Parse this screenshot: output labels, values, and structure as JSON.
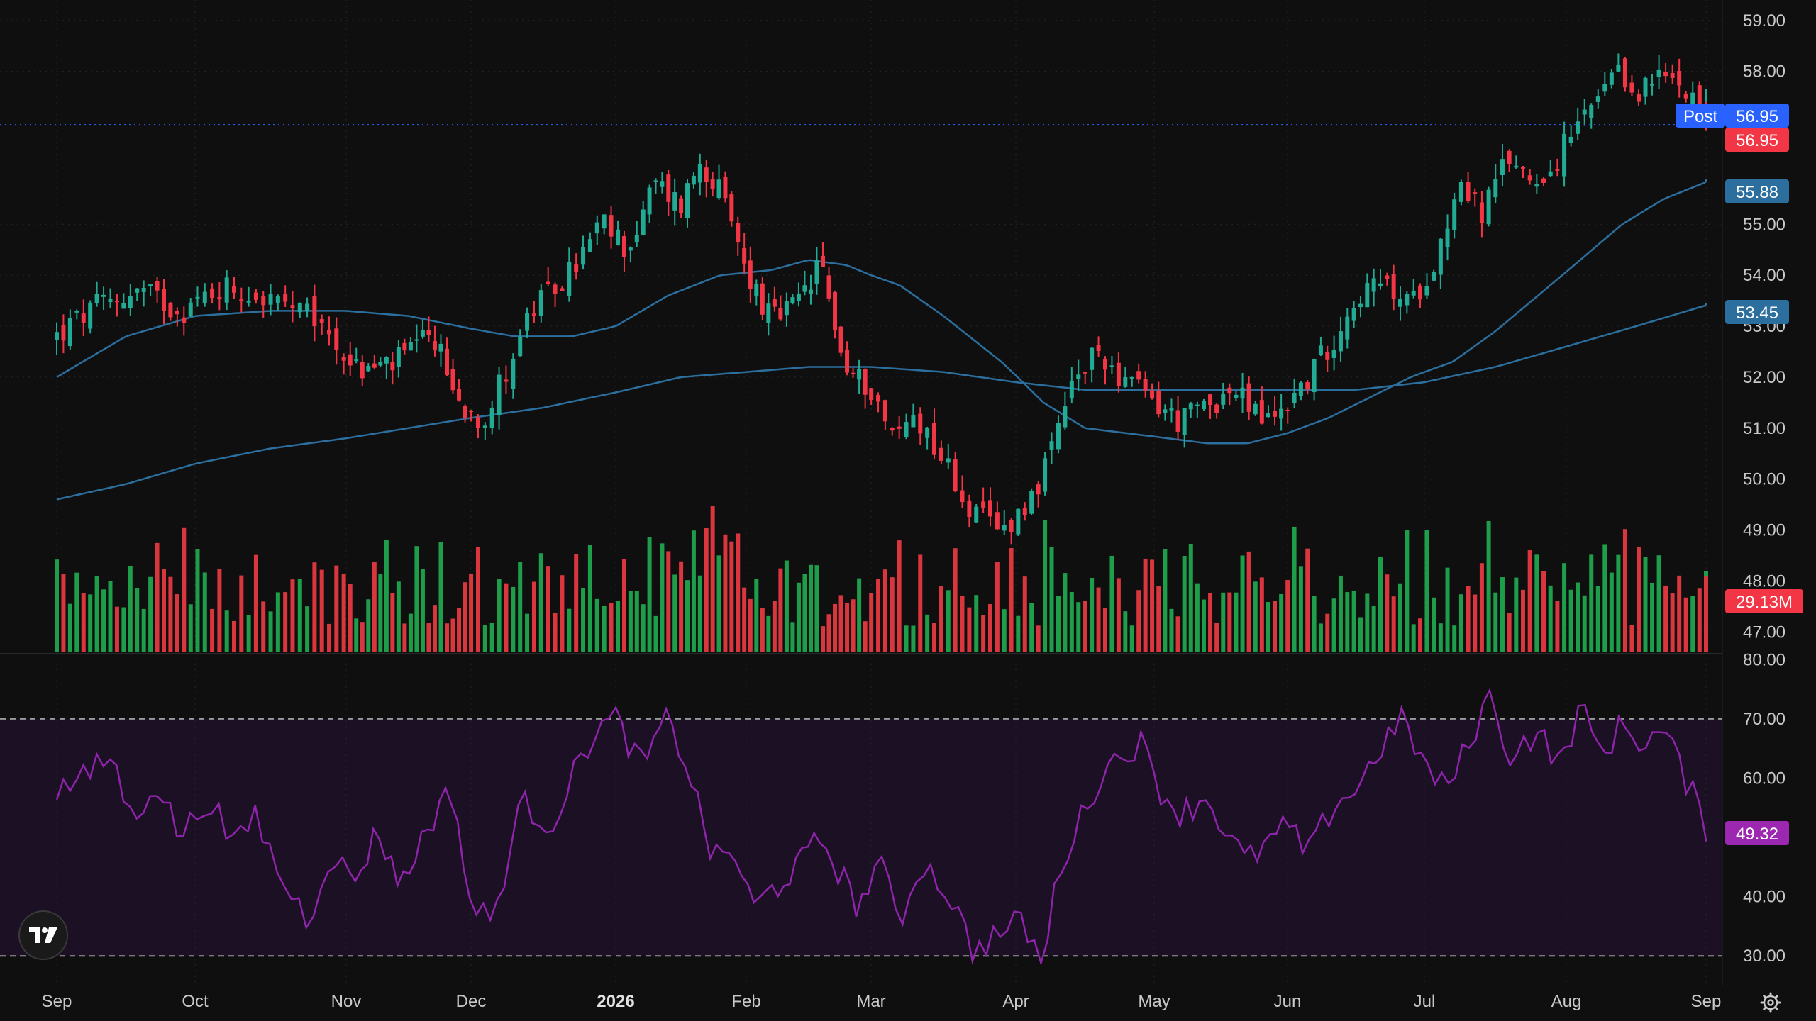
{
  "colors": {
    "background": "#0f0f0f",
    "grid": "#262626",
    "up": "#22ab94",
    "down": "#f23645",
    "volume_up": "#1e9e4a",
    "volume_down": "#d9363e",
    "ma_fast": "#2c6f9e",
    "ma_slow": "#2c6f9e",
    "rsi_line": "#8e24aa",
    "rsi_band": "#1c1024",
    "post_badge": "#2962ff",
    "last_price_badge": "#f23645",
    "ma_badge": "#2c6f9e",
    "rsi_badge": "#9c27b0"
  },
  "price_axis": {
    "labels": [
      "59.00",
      "58.00",
      "56.95",
      "55.88",
      "55.00",
      "54.00",
      "53.45",
      "53.00",
      "52.00",
      "51.00",
      "50.00",
      "49.00",
      "48.00",
      "47.00"
    ],
    "ylim": [
      46.6,
      59.4
    ]
  },
  "rsi_axis": {
    "labels": [
      "80.00",
      "70.00",
      "60.00",
      "50.00",
      "40.00",
      "30.00"
    ],
    "ylim": [
      25,
      81
    ],
    "upper_band": 70,
    "lower_band": 30
  },
  "badges": {
    "post_label": "Post",
    "post_price": "56.95",
    "last_price": "56.95",
    "ma_fast_value": "55.88",
    "ma_slow_value": "53.45",
    "volume_value": "29.13M",
    "rsi_value": "49.32"
  },
  "time_axis": {
    "labels": [
      {
        "text": "Sep",
        "bold": false
      },
      {
        "text": "Oct",
        "bold": false
      },
      {
        "text": "Nov",
        "bold": false
      },
      {
        "text": "Dec",
        "bold": false
      },
      {
        "text": "2026",
        "bold": true
      },
      {
        "text": "Feb",
        "bold": false
      },
      {
        "text": "Mar",
        "bold": false
      },
      {
        "text": "Apr",
        "bold": false
      },
      {
        "text": "May",
        "bold": false
      },
      {
        "text": "Jun",
        "bold": false
      },
      {
        "text": "Jul",
        "bold": false
      },
      {
        "text": "Aug",
        "bold": false
      },
      {
        "text": "Sep",
        "bold": false
      }
    ],
    "month_index": [
      0,
      1,
      2,
      3,
      4,
      5,
      6,
      7,
      8,
      9,
      10,
      11,
      12
    ]
  },
  "chart_data": {
    "type": "candlestick",
    "description_series": [
      "price",
      "ma50",
      "ma200",
      "volume",
      "rsi"
    ],
    "x_months": [
      "Sep",
      "Oct",
      "Nov",
      "Dec",
      "2026",
      "Feb",
      "Mar",
      "Apr",
      "May",
      "Jun",
      "Jul",
      "Aug",
      "Sep"
    ],
    "close_keypoints": [
      [
        0.0,
        52.8
      ],
      [
        0.3,
        53.4
      ],
      [
        0.6,
        53.7
      ],
      [
        0.9,
        53.3
      ],
      [
        1.2,
        53.8
      ],
      [
        1.5,
        53.5
      ],
      [
        1.8,
        53.1
      ],
      [
        2.1,
        52.1
      ],
      [
        2.4,
        52.3
      ],
      [
        2.7,
        52.8
      ],
      [
        2.9,
        51.5
      ],
      [
        3.1,
        51.2
      ],
      [
        3.4,
        53.2
      ],
      [
        3.7,
        54.1
      ],
      [
        3.9,
        55.0
      ],
      [
        4.1,
        54.5
      ],
      [
        4.3,
        55.8
      ],
      [
        4.5,
        55.4
      ],
      [
        4.65,
        56.3
      ],
      [
        4.8,
        55.6
      ],
      [
        5.0,
        54.1
      ],
      [
        5.2,
        53.1
      ],
      [
        5.4,
        53.4
      ],
      [
        5.6,
        54.2
      ],
      [
        5.8,
        52.1
      ],
      [
        6.0,
        51.8
      ],
      [
        6.15,
        50.8
      ],
      [
        6.3,
        51.3
      ],
      [
        6.5,
        50.4
      ],
      [
        6.7,
        49.3
      ],
      [
        6.9,
        49.0
      ],
      [
        7.1,
        49.6
      ],
      [
        7.25,
        50.4
      ],
      [
        7.4,
        51.8
      ],
      [
        7.6,
        52.5
      ],
      [
        7.8,
        51.9
      ],
      [
        8.0,
        51.5
      ],
      [
        8.2,
        51.1
      ],
      [
        8.4,
        51.5
      ],
      [
        8.6,
        51.7
      ],
      [
        8.85,
        51.1
      ],
      [
        9.1,
        51.8
      ],
      [
        9.3,
        52.6
      ],
      [
        9.5,
        53.6
      ],
      [
        9.7,
        53.8
      ],
      [
        9.9,
        53.4
      ],
      [
        10.1,
        54.5
      ],
      [
        10.25,
        55.9
      ],
      [
        10.4,
        55.2
      ],
      [
        10.6,
        56.3
      ],
      [
        10.75,
        55.9
      ],
      [
        10.9,
        56.1
      ],
      [
        11.05,
        56.8
      ],
      [
        11.2,
        57.3
      ],
      [
        11.35,
        57.9
      ],
      [
        11.5,
        57.6
      ],
      [
        11.7,
        57.9
      ],
      [
        11.9,
        57.7
      ],
      [
        12.05,
        56.95
      ]
    ],
    "ma50_keypoints": [
      [
        0.0,
        52.0
      ],
      [
        0.5,
        52.8
      ],
      [
        1.0,
        53.2
      ],
      [
        1.5,
        53.3
      ],
      [
        2.0,
        53.3
      ],
      [
        2.5,
        53.2
      ],
      [
        2.9,
        53.0
      ],
      [
        3.3,
        52.8
      ],
      [
        3.7,
        52.8
      ],
      [
        4.0,
        53.0
      ],
      [
        4.4,
        53.6
      ],
      [
        4.8,
        54.0
      ],
      [
        5.2,
        54.1
      ],
      [
        5.5,
        54.3
      ],
      [
        5.8,
        54.2
      ],
      [
        6.2,
        53.8
      ],
      [
        6.5,
        53.2
      ],
      [
        6.9,
        52.3
      ],
      [
        7.2,
        51.5
      ],
      [
        7.5,
        51.0
      ],
      [
        7.8,
        50.9
      ],
      [
        8.1,
        50.8
      ],
      [
        8.4,
        50.7
      ],
      [
        8.7,
        50.7
      ],
      [
        9.0,
        50.9
      ],
      [
        9.3,
        51.2
      ],
      [
        9.6,
        51.6
      ],
      [
        9.9,
        52.0
      ],
      [
        10.2,
        52.3
      ],
      [
        10.5,
        52.9
      ],
      [
        10.8,
        53.6
      ],
      [
        11.1,
        54.3
      ],
      [
        11.4,
        55.0
      ],
      [
        11.7,
        55.5
      ],
      [
        12.05,
        55.88
      ]
    ],
    "ma200_keypoints": [
      [
        0.0,
        49.6
      ],
      [
        0.5,
        49.9
      ],
      [
        1.0,
        50.3
      ],
      [
        1.5,
        50.6
      ],
      [
        2.0,
        50.8
      ],
      [
        2.5,
        51.0
      ],
      [
        3.0,
        51.2
      ],
      [
        3.5,
        51.4
      ],
      [
        4.0,
        51.7
      ],
      [
        4.5,
        52.0
      ],
      [
        5.0,
        52.1
      ],
      [
        5.5,
        52.2
      ],
      [
        6.0,
        52.2
      ],
      [
        6.5,
        52.1
      ],
      [
        7.0,
        51.9
      ],
      [
        7.5,
        51.75
      ],
      [
        8.0,
        51.75
      ],
      [
        8.5,
        51.75
      ],
      [
        9.0,
        51.75
      ],
      [
        9.5,
        51.75
      ],
      [
        10.0,
        51.9
      ],
      [
        10.5,
        52.2
      ],
      [
        11.0,
        52.6
      ],
      [
        11.5,
        53.0
      ],
      [
        12.05,
        53.45
      ]
    ],
    "volume_profile": {
      "min_m": 10,
      "max_m": 58,
      "axis_max_m": 60,
      "last_m": 29.13
    },
    "rsi_keypoints": [
      [
        0.0,
        58
      ],
      [
        0.2,
        60
      ],
      [
        0.4,
        64
      ],
      [
        0.55,
        52
      ],
      [
        0.7,
        60
      ],
      [
        0.9,
        50
      ],
      [
        1.1,
        57
      ],
      [
        1.25,
        48
      ],
      [
        1.4,
        54
      ],
      [
        1.55,
        44
      ],
      [
        1.75,
        36
      ],
      [
        1.9,
        48
      ],
      [
        2.05,
        42
      ],
      [
        2.25,
        51
      ],
      [
        2.45,
        42
      ],
      [
        2.65,
        52
      ],
      [
        2.85,
        58
      ],
      [
        3.0,
        38
      ],
      [
        3.15,
        36
      ],
      [
        3.35,
        56
      ],
      [
        3.55,
        52
      ],
      [
        3.7,
        60
      ],
      [
        3.85,
        68
      ],
      [
        4.0,
        70
      ],
      [
        4.2,
        62
      ],
      [
        4.4,
        70
      ],
      [
        4.55,
        62
      ],
      [
        4.75,
        46
      ],
      [
        4.9,
        48
      ],
      [
        5.05,
        38
      ],
      [
        5.25,
        42
      ],
      [
        5.45,
        46
      ],
      [
        5.6,
        50
      ],
      [
        5.75,
        44
      ],
      [
        5.9,
        38
      ],
      [
        6.05,
        46
      ],
      [
        6.2,
        36
      ],
      [
        6.35,
        46
      ],
      [
        6.55,
        40
      ],
      [
        6.7,
        31
      ],
      [
        6.9,
        34
      ],
      [
        7.05,
        36
      ],
      [
        7.2,
        28
      ],
      [
        7.3,
        44
      ],
      [
        7.45,
        52
      ],
      [
        7.6,
        60
      ],
      [
        7.75,
        64
      ],
      [
        7.9,
        66
      ],
      [
        8.05,
        58
      ],
      [
        8.2,
        54
      ],
      [
        8.4,
        57
      ],
      [
        8.55,
        50
      ],
      [
        8.7,
        46
      ],
      [
        8.85,
        49
      ],
      [
        9.0,
        52
      ],
      [
        9.15,
        47
      ],
      [
        9.35,
        56
      ],
      [
        9.5,
        58
      ],
      [
        9.7,
        66
      ],
      [
        9.85,
        70
      ],
      [
        10.0,
        62
      ],
      [
        10.15,
        58
      ],
      [
        10.3,
        65
      ],
      [
        10.45,
        74
      ],
      [
        10.6,
        64
      ],
      [
        10.8,
        68
      ],
      [
        10.95,
        62
      ],
      [
        11.1,
        72
      ],
      [
        11.25,
        64
      ],
      [
        11.4,
        69
      ],
      [
        11.55,
        66
      ],
      [
        11.7,
        68
      ],
      [
        11.85,
        60
      ],
      [
        12.05,
        49.32
      ]
    ],
    "title": "",
    "xlabel": "",
    "ylabel": ""
  }
}
